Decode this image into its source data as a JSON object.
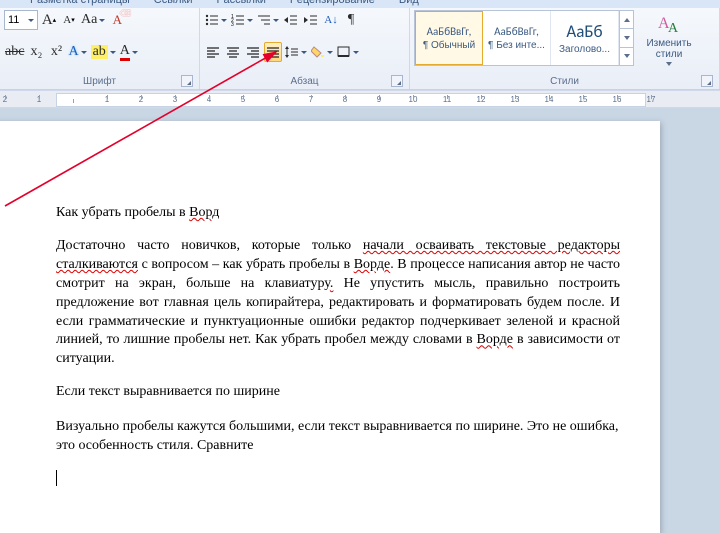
{
  "tabs": {
    "page_layout": "Разметка страницы",
    "references": "Ссылки",
    "mailings": "Рассылки",
    "review": "Рецензирование",
    "view": "Вид"
  },
  "font": {
    "size_value": "11",
    "grow_glyph": "A",
    "shrink_glyph": "A",
    "change_case_glyph": "Aa",
    "clear_fmt_glyph": "A",
    "sub_glyph": "x₂",
    "sup_glyph": "x²",
    "abc_glyph": "abc",
    "label": "Шрифт",
    "highlight_glyph": "ab",
    "fontcolor_glyph": "A",
    "texteffects_glyph": "A"
  },
  "paragraph": {
    "label": "Абзац"
  },
  "styles": {
    "label": "Стили",
    "sample": "АаБбВвГг,",
    "sample_big": "АаБб",
    "item1": "¶ Обычный",
    "item2": "¶ Без инте...",
    "item3": "Заголово...",
    "change": "Изменить стили"
  },
  "ruler_ticks": [
    "2",
    "1",
    "",
    "1",
    "2",
    "3",
    "4",
    "5",
    "6",
    "7",
    "8",
    "9",
    "10",
    "11",
    "12",
    "13",
    "14",
    "15",
    "16",
    "17"
  ],
  "doc": {
    "title": "Как убрать пробелы в Ворд",
    "p1": "Достаточно часто новичков, которые только начали осваивать текстовые редакторы сталкиваются с вопросом – как убрать пробелы в Ворде. В процессе написания автор не часто смотрит на экран, больше на клавиатуру. Не упустить мысль, правильно построить предложение вот главная цель копирайтера, редактировать и форматировать будем после. И если грамматические и пунктуационные ошибки редактор подчеркивает зеленой и красной линией, то лишние пробелы нет. Как убрать пробел между словами в Ворде в зависимости от ситуации.",
    "p2": "Если текст выравнивается по ширине",
    "p3": "Визуально пробелы кажутся большими, если текст выравнивается по ширине. Это не ошибка, это особенность стиля. Сравните"
  }
}
